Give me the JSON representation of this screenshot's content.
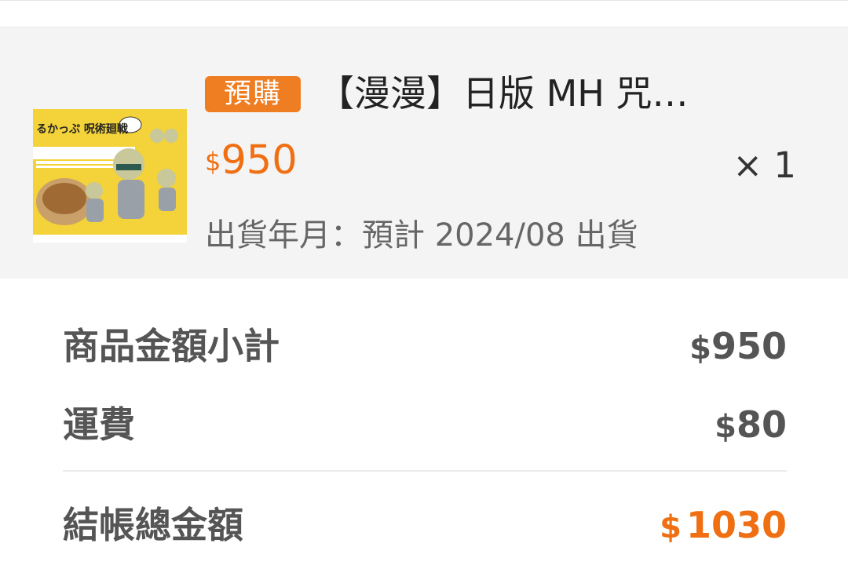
{
  "order_item": {
    "badge": "預購",
    "title": "【漫漫】日版 MH 咒…",
    "price_currency": "$",
    "price_value": "950",
    "quantity": "× 1",
    "shipping_date": "出貨年月：預計 2024/08 出貨",
    "thumbnail_text": "るかっぷ 呪術廻戦"
  },
  "summary": {
    "subtotal_label": "商品金額小計",
    "subtotal_currency": "$",
    "subtotal_value": "950",
    "shipping_label": "運費",
    "shipping_currency": "$",
    "shipping_value": "80",
    "total_label": "結帳總金額",
    "total_currency": "$",
    "total_value": "1030"
  },
  "colors": {
    "accent": "#ef6f12",
    "badge_bg": "#ef7d22",
    "card_bg": "#f4f4f4",
    "label_text": "#555555"
  }
}
